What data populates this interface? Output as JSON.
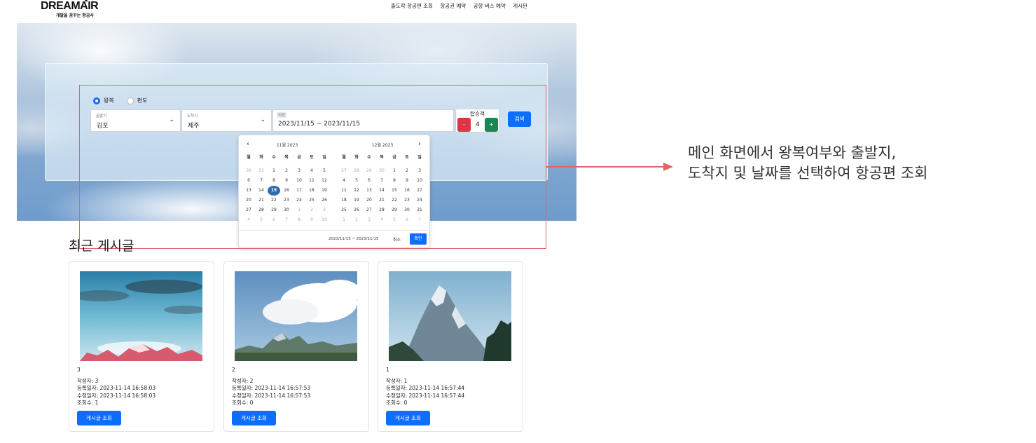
{
  "header": {
    "logo_word": "DREAMAIR",
    "logo_tagline": "개발을 꿈꾸는 항공사",
    "nav": [
      "출도착 항공편 조회",
      "항공권 예약",
      "공항 버스 예약",
      "게시판"
    ]
  },
  "search": {
    "trip_types": [
      "왕복",
      "편도"
    ],
    "selected_trip_type": "왕복",
    "departure": {
      "label": "출발지",
      "value": "김포"
    },
    "arrival": {
      "label": "도착지",
      "value": "제주"
    },
    "dates": {
      "label": "여정",
      "value": "2023/11/15 ~ 2023/11/15"
    },
    "passengers": {
      "label": "탑승객",
      "count": "4",
      "minus": "-",
      "plus": "+"
    },
    "search_button": "검색"
  },
  "datepicker": {
    "prev_arrow": "‹",
    "next_arrow": "›",
    "weekdays": [
      "월",
      "화",
      "수",
      "목",
      "금",
      "토",
      "일"
    ],
    "months": [
      {
        "title": "11월 2023",
        "weeks": [
          [
            "30",
            "31",
            "1",
            "2",
            "3",
            "4",
            "5"
          ],
          [
            "6",
            "7",
            "8",
            "9",
            "10",
            "11",
            "12"
          ],
          [
            "13",
            "14",
            "15",
            "16",
            "17",
            "18",
            "19"
          ],
          [
            "20",
            "21",
            "22",
            "23",
            "24",
            "25",
            "26"
          ],
          [
            "27",
            "28",
            "29",
            "30",
            "1",
            "2",
            "3"
          ],
          [
            "4",
            "5",
            "6",
            "7",
            "8",
            "9",
            "10"
          ]
        ],
        "leading_muted": 2,
        "trailing_muted": 10,
        "selected_day": "15"
      },
      {
        "title": "12월 2023",
        "weeks": [
          [
            "27",
            "28",
            "29",
            "30",
            "1",
            "2",
            "3"
          ],
          [
            "4",
            "5",
            "6",
            "7",
            "8",
            "9",
            "10"
          ],
          [
            "11",
            "12",
            "13",
            "14",
            "15",
            "16",
            "17"
          ],
          [
            "18",
            "19",
            "20",
            "21",
            "22",
            "23",
            "24"
          ],
          [
            "25",
            "26",
            "27",
            "28",
            "29",
            "30",
            "31"
          ],
          [
            "1",
            "2",
            "3",
            "4",
            "5",
            "6",
            "7"
          ]
        ],
        "leading_muted": 4,
        "trailing_muted": 7,
        "selected_day": null
      }
    ],
    "range_text": "2023/11/15 ~ 2023/11/15",
    "cancel": "취소",
    "confirm": "확인"
  },
  "annotation": {
    "line1": "메인 화면에서 왕복여부와 출발지,",
    "line2": "도착지 및 날짜를 선택하여 항공편 조회",
    "color": "#e06666"
  },
  "posts": {
    "title": "최근 게시글",
    "items": [
      {
        "number": "3",
        "author": "작성자: 3",
        "created": "등록일자: 2023-11-14 16:58:03",
        "modified": "수정일자: 2023-11-14 16:58:03",
        "views": "조회수: 1",
        "button": "게시글 조회"
      },
      {
        "number": "2",
        "author": "작성자: 2",
        "created": "등록일자: 2023-11-14 16:57:53",
        "modified": "수정일자: 2023-11-14 16:57:53",
        "views": "조회수: 0",
        "button": "게시글 조회"
      },
      {
        "number": "1",
        "author": "작성자: 1",
        "created": "등록일자: 2023-11-14 16:57:44",
        "modified": "수정일자: 2023-11-14 16:57:44",
        "views": "조회수: 0",
        "button": "게시글 조회"
      }
    ]
  },
  "colors": {
    "primary": "#0d6efd",
    "danger": "#dc3545",
    "success": "#198754",
    "selected_day": "#2e6db3"
  }
}
